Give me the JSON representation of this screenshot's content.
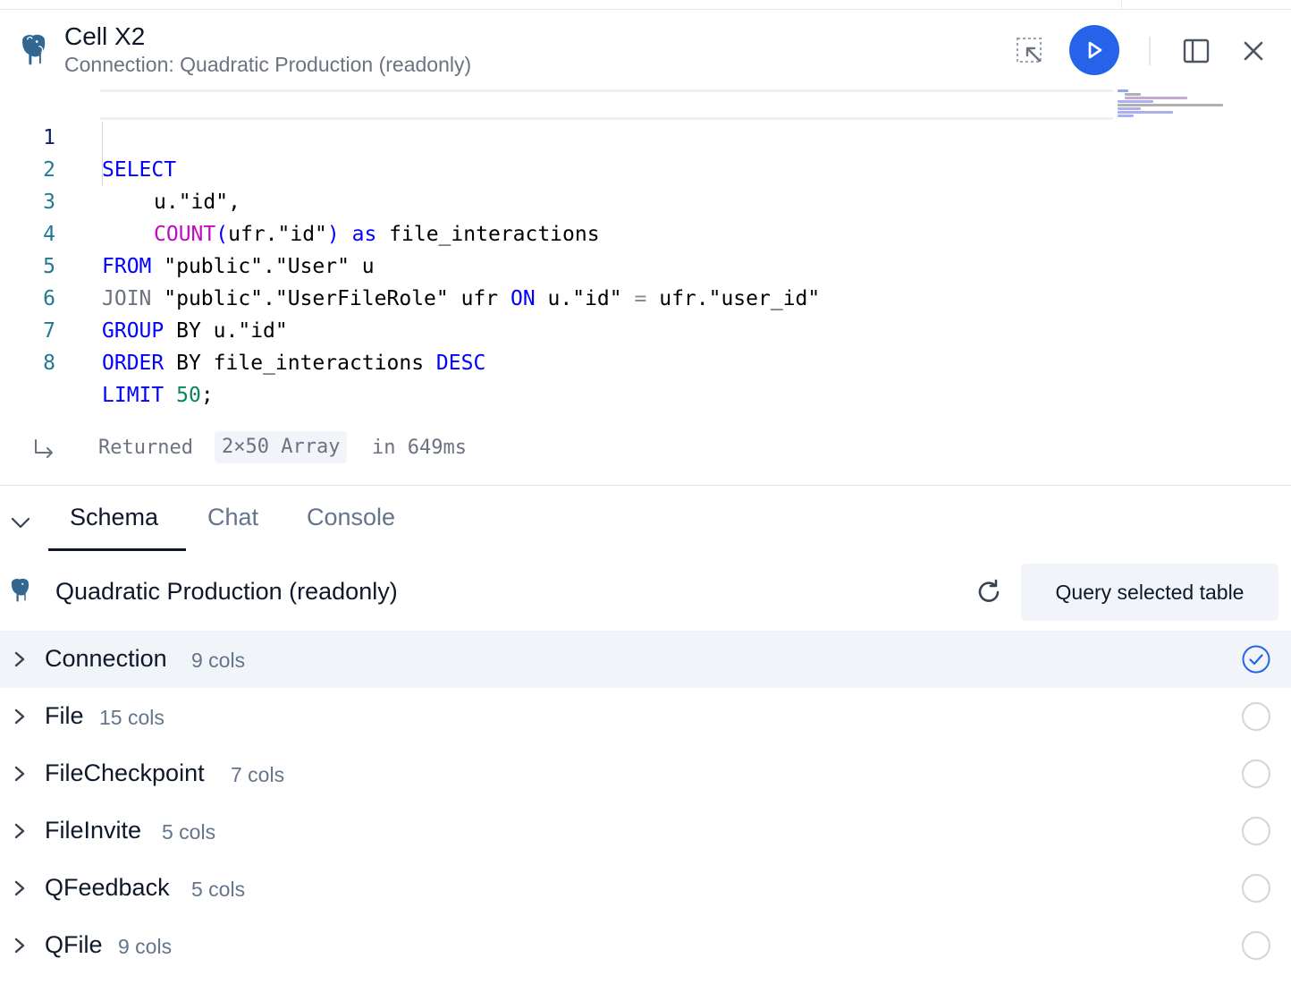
{
  "header": {
    "title": "Cell X2",
    "subtitle": "Connection: Quadratic Production (readonly)",
    "accent": "#2563eb"
  },
  "editor": {
    "line_numbers": [
      "1",
      "2",
      "3",
      "4",
      "5",
      "6",
      "7",
      "8"
    ],
    "tokens": {
      "l1_select": "SELECT",
      "l2_a": "u.\"id\",",
      "l3_count": "COUNT",
      "l3_paren_open": "(",
      "l3_arg": "ufr.\"id\"",
      "l3_paren_close": ")",
      "l3_as": "as",
      "l3_alias": "file_interactions",
      "l4_from": "FROM",
      "l4_rest": "\"public\".\"User\" u",
      "l5_join": "JOIN",
      "l5_table": "\"public\".\"UserFileRole\" ufr",
      "l5_on": "ON",
      "l5_left": "u.\"id\"",
      "l5_eq": "=",
      "l5_right": "ufr.\"user_id\"",
      "l6_group": "GROUP",
      "l6_rest": "BY u.\"id\"",
      "l7_order": "ORDER",
      "l7_rest": "BY file_interactions",
      "l7_desc": "DESC",
      "l8_limit": "LIMIT",
      "l8_num": "50",
      "l8_semi": ";"
    }
  },
  "result": {
    "prefix": "Returned",
    "shape": "2×50 Array",
    "suffix": "in 649ms"
  },
  "tabs": [
    {
      "label": "Schema",
      "active": true
    },
    {
      "label": "Chat",
      "active": false
    },
    {
      "label": "Console",
      "active": false
    }
  ],
  "schema": {
    "connection_name": "Quadratic Production (readonly)",
    "query_button": "Query selected table",
    "tables": [
      {
        "name": "Connection",
        "cols": "9 cols",
        "selected": true
      },
      {
        "name": "File",
        "cols": "15 cols",
        "selected": false
      },
      {
        "name": "FileCheckpoint",
        "cols": "7 cols",
        "selected": false
      },
      {
        "name": "FileInvite",
        "cols": "5 cols",
        "selected": false
      },
      {
        "name": "QFeedback",
        "cols": "5 cols",
        "selected": false
      },
      {
        "name": "QFile",
        "cols": "9 cols",
        "selected": false
      }
    ]
  },
  "icons": {
    "db": "postgres-elephant-icon",
    "select": "select-region-icon",
    "run": "play-icon",
    "panel": "side-panel-icon",
    "close": "close-icon",
    "return": "return-arrow-icon",
    "collapse": "chevron-down-icon",
    "refresh": "refresh-icon",
    "expand": "chevron-right-icon",
    "check": "check-circle-icon"
  }
}
